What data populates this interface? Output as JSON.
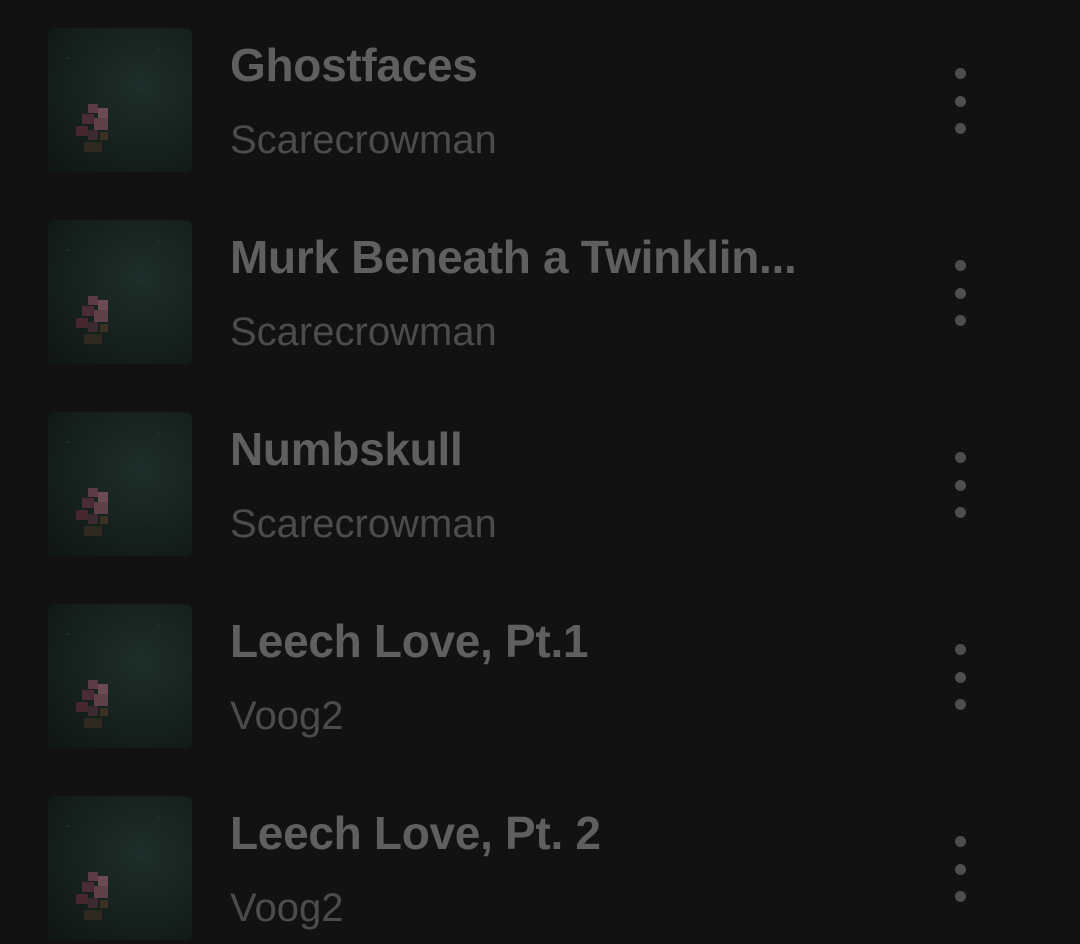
{
  "tracks": [
    {
      "title": "Ghostfaces",
      "artist": "Scarecrowman",
      "art_icon": "album-art-icon",
      "menu_icon": "more-vertical-icon"
    },
    {
      "title": "Murk Beneath a Twinklin...",
      "artist": "Scarecrowman",
      "art_icon": "album-art-icon",
      "menu_icon": "more-vertical-icon"
    },
    {
      "title": "Numbskull",
      "artist": "Scarecrowman",
      "art_icon": "album-art-icon",
      "menu_icon": "more-vertical-icon"
    },
    {
      "title": "Leech Love, Pt.1",
      "artist": "Voog2",
      "art_icon": "album-art-icon",
      "menu_icon": "more-vertical-icon"
    },
    {
      "title": "Leech Love, Pt. 2",
      "artist": "Voog2",
      "art_icon": "album-art-icon",
      "menu_icon": "more-vertical-icon"
    }
  ],
  "colors": {
    "background": "#121212",
    "title_text": "#5f5f5f",
    "artist_text": "#4c4c4c",
    "menu_dots": "#4e4e4e"
  }
}
